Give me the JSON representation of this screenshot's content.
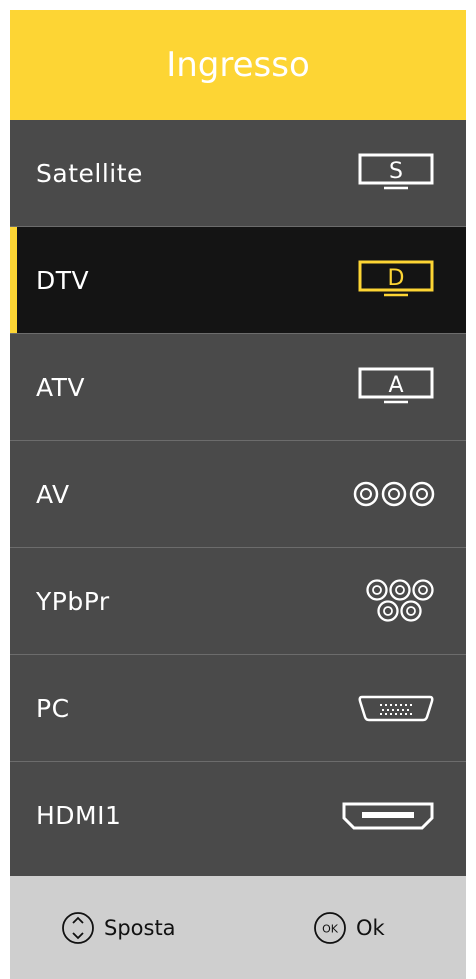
{
  "header": {
    "title": "Ingresso"
  },
  "items": [
    {
      "label": "Satellite",
      "icon": "tv-s-icon",
      "letter": "S"
    },
    {
      "label": "DTV",
      "icon": "tv-d-icon",
      "letter": "D",
      "selected": true
    },
    {
      "label": "ATV",
      "icon": "tv-a-icon",
      "letter": "A"
    },
    {
      "label": "AV",
      "icon": "rca-connectors-icon"
    },
    {
      "label": "YPbPr",
      "icon": "component-connectors-icon"
    },
    {
      "label": "PC",
      "icon": "vga-port-icon"
    },
    {
      "label": "HDMI1",
      "icon": "hdmi-port-icon"
    }
  ],
  "footer": {
    "move_label": "Sposta",
    "ok_label": "Ok",
    "ok_icon_text": "OK",
    "move_icon": "updown-arrows-icon"
  },
  "colors": {
    "accent": "#fdd534",
    "panel": "#4a4a4a",
    "selected_bg": "#141414",
    "footer_bg": "#cfcfcf"
  }
}
